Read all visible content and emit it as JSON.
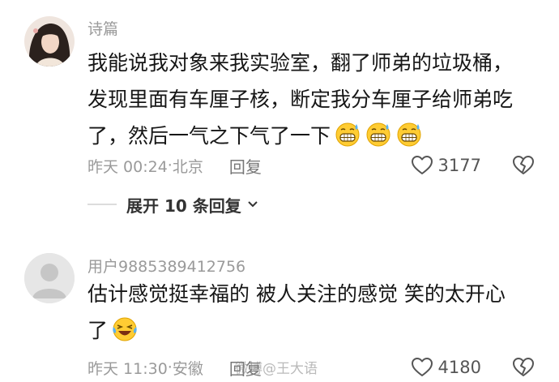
{
  "comments": [
    {
      "username": "诗篇",
      "text_lines": [
        "我能说我对象来我实验室，翻了师弟的垃圾桶，",
        "发现里面有车厘子核，断定我分车厘子给师弟吃",
        "了，然后一气之下气了一下"
      ],
      "emoji": "grimacing-face-icon",
      "time": "昨天 00:24",
      "location": "北京",
      "reply_label": "回复",
      "likes": "3177",
      "expand_label": "展开 10 条回复"
    },
    {
      "username": "用户9885389412756",
      "text_lines": [
        "估计感觉挺幸福的 被人关注的感觉 笑的太开心",
        "了"
      ],
      "emoji": "laughing-crying-face-icon",
      "time": "昨天 11:30",
      "location": "安徽",
      "reply_label": "回复",
      "likes": "4180"
    }
  ],
  "watermark": "微博@王大语"
}
